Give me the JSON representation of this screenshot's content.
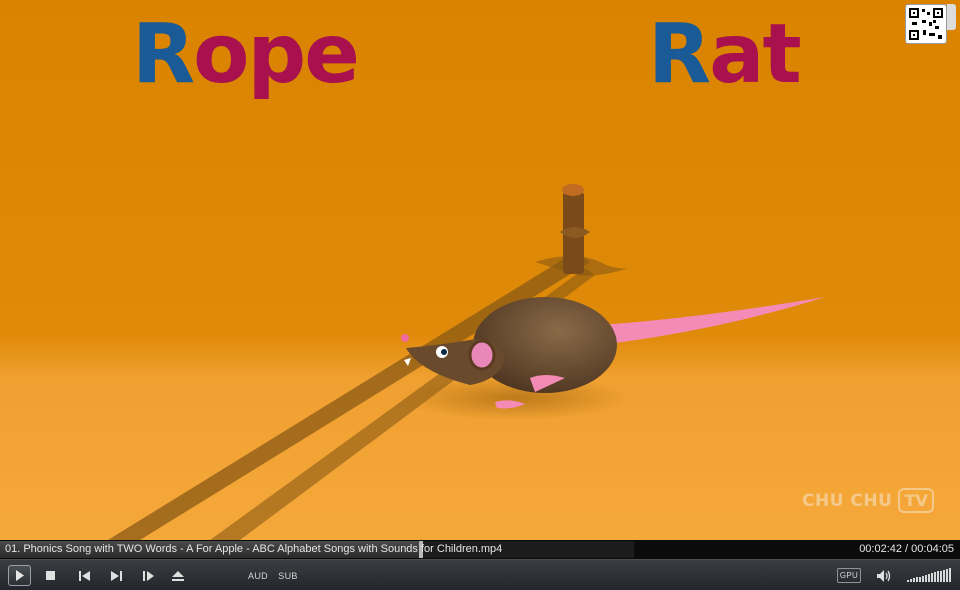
{
  "video": {
    "left_word": {
      "first_letter": "R",
      "rest": "ope"
    },
    "right_word": {
      "first_letter": "R",
      "rest": "at"
    },
    "watermark": {
      "text": "CHU CHU",
      "badge": "TV"
    },
    "colors": {
      "background": "#dc8400",
      "floor": "#f3a634",
      "letter_blue": "#1a5a96",
      "letter_magenta": "#a8104e"
    }
  },
  "status": {
    "filename": "01. Phonics Song with TWO Words - A For Apple - ABC Alphabet Songs with Sounds for Children.mp4",
    "time": "00:02:42 / 00:04:05",
    "progress": 0.661
  },
  "controls": {
    "aud_label": "AUD",
    "sub_label": "SUB",
    "gpu_label": "GPU",
    "volume_level": 1.0,
    "icons": [
      "play-icon",
      "stop-icon",
      "previous-icon",
      "next-icon",
      "frame-step-icon",
      "eject-icon",
      "speaker-icon"
    ]
  }
}
